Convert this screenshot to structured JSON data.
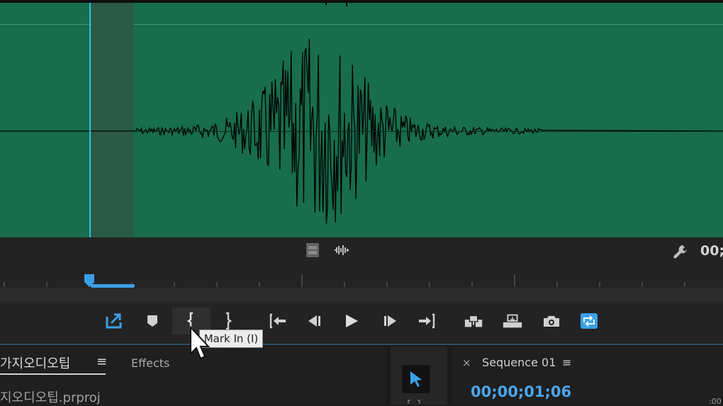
{
  "waveform": {
    "colors": {
      "background": "#186d4d",
      "playhead": "#3ab4ea",
      "trace": "#000000"
    }
  },
  "controls": {
    "timecode_right": "00;",
    "buttons": [
      {
        "name": "export-frame-button",
        "icon": "insert-export-icon"
      },
      {
        "name": "add-marker-button",
        "icon": "marker-icon"
      },
      {
        "name": "mark-in-button",
        "icon": "mark-in-icon"
      },
      {
        "name": "mark-out-button",
        "icon": "mark-out-icon"
      },
      {
        "name": "go-to-in-button",
        "icon": "go-to-in-icon"
      },
      {
        "name": "step-back-button",
        "icon": "step-back-icon"
      },
      {
        "name": "play-button",
        "icon": "play-icon"
      },
      {
        "name": "step-forward-button",
        "icon": "step-forward-icon"
      },
      {
        "name": "go-to-out-button",
        "icon": "go-to-out-icon"
      },
      {
        "name": "insert-button",
        "icon": "insert-icon"
      },
      {
        "name": "overwrite-button",
        "icon": "overwrite-icon"
      },
      {
        "name": "camera-button",
        "icon": "camera-icon"
      },
      {
        "name": "loop-button",
        "icon": "loop-icon"
      }
    ],
    "tooltip": "Mark In (I)"
  },
  "project_panel": {
    "tab_label": "가지오디오팁",
    "menu_glyph": "≡",
    "effects_tab": "Effects",
    "file_name": "지오디오팁.prproj"
  },
  "sequence_panel": {
    "close_glyph": "×",
    "title": "Sequence 01",
    "menu_glyph": "≡",
    "timecode": "00;00;01;06",
    "edge_text": ":00"
  }
}
